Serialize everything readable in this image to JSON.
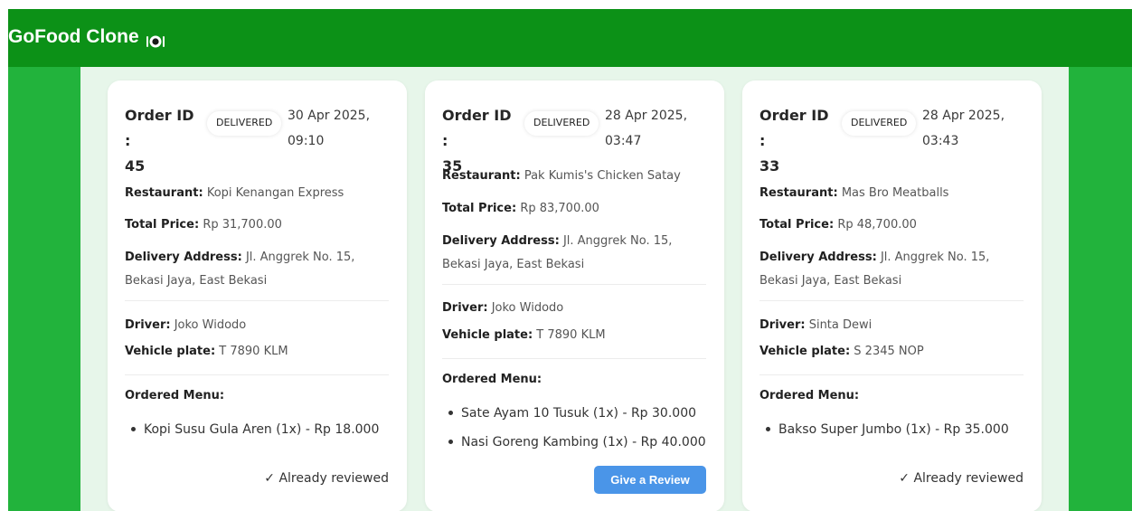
{
  "navbar": {
    "brand": "GoFood Clone",
    "brand_icon": "plate-cutlery-icon"
  },
  "labels": {
    "order_id": "Order ID :",
    "restaurant": "Restaurant:",
    "total_price": "Total Price:",
    "delivery_address": "Delivery Address:",
    "driver": "Driver:",
    "vehicle_plate": "Vehicle plate:",
    "ordered_menu": "Ordered Menu:"
  },
  "orders": [
    {
      "id": "45",
      "status": "DELIVERED",
      "date": "30 Apr 2025, 09:10",
      "restaurant": "Kopi Kenangan Express",
      "total_price": "Rp 31,700.00",
      "delivery_address": "Jl. Anggrek No. 15, Bekasi Jaya, East Bekasi",
      "driver": "Joko Widodo",
      "vehicle_plate": "T 7890 KLM",
      "menu": [
        "Kopi Susu Gula Aren (1x) - Rp 18.000"
      ],
      "review_state": "✓ Already reviewed"
    },
    {
      "id": "35",
      "status": "DELIVERED",
      "date": "28 Apr 2025, 03:47",
      "restaurant": "Pak Kumis's Chicken Satay",
      "total_price": "Rp 83,700.00",
      "delivery_address": "Jl. Anggrek No. 15, Bekasi Jaya, East Bekasi",
      "driver": "Joko Widodo",
      "vehicle_plate": "T 7890 KLM",
      "menu": [
        "Sate Ayam 10 Tusuk (1x) - Rp 30.000",
        "Nasi Goreng Kambing (1x) - Rp 40.000"
      ],
      "review_button": "Give a Review"
    },
    {
      "id": "33",
      "status": "DELIVERED",
      "date": "28 Apr 2025, 03:43",
      "restaurant": "Mas Bro Meatballs",
      "total_price": "Rp 48,700.00",
      "delivery_address": "Jl. Anggrek No. 15, Bekasi Jaya, East Bekasi",
      "driver": "Sinta Dewi",
      "vehicle_plate": "S 2345 NOP",
      "menu": [
        "Bakso Super Jumbo (1x) - Rp 35.000"
      ],
      "review_state": "✓ Already reviewed"
    }
  ],
  "colors": {
    "navbar": "#0c9117",
    "background": "#22b33c",
    "content": "#e7f6ea",
    "review_button": "#4a95e8"
  }
}
